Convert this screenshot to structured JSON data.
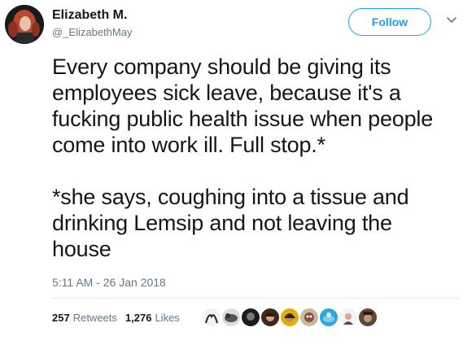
{
  "user": {
    "display_name": "Elizabeth M.",
    "screen_name": "@_ElizabethMay"
  },
  "header": {
    "follow_label": "Follow",
    "more_icon": "chevron-down-icon"
  },
  "tweet": {
    "text": "Every company should be giving its\nemployees sick leave, because it's a\nfucking public health issue when people\ncome into work ill. Full stop.*\n\n*she says, coughing into a tissue and\ndrinking Lemsip and not leaving the\nhouse",
    "timestamp": "5:11 AM - 26 Jan 2018"
  },
  "stats": {
    "retweets_count": "257",
    "retweets_label": "Retweets",
    "likes_count": "1,276",
    "likes_label": "Likes"
  },
  "colors": {
    "accent": "#1da1f2",
    "text": "#14171a",
    "secondary": "#657786",
    "divider": "#e6ecf0"
  }
}
